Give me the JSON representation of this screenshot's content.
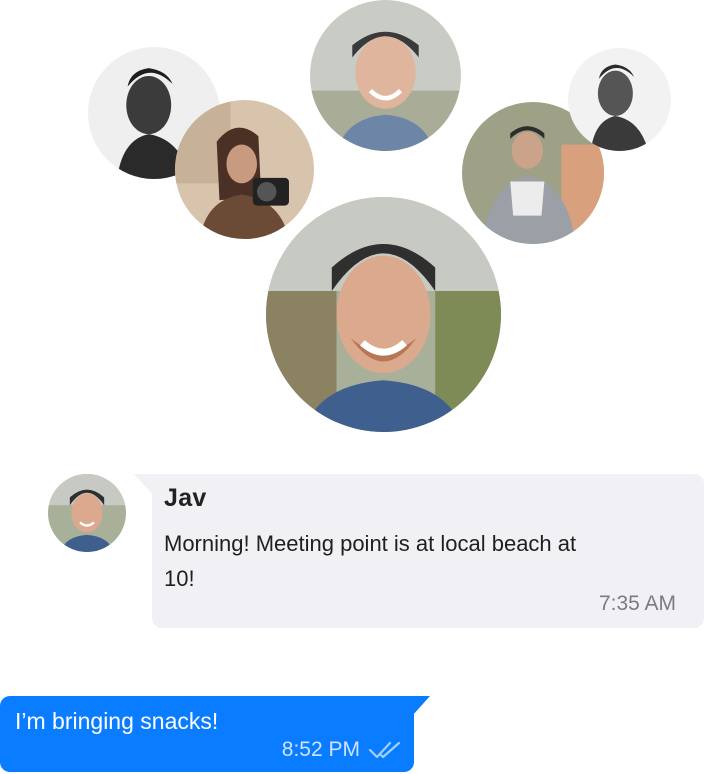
{
  "avatars": [
    {
      "id": "avatar-1",
      "icon": "person-portrait-bw-icon",
      "palette": "grayscale"
    },
    {
      "id": "avatar-2",
      "icon": "person-with-camera-icon",
      "palette": "warm"
    },
    {
      "id": "avatar-3",
      "icon": "person-smiling-cap-icon",
      "palette": "faded"
    },
    {
      "id": "avatar-4",
      "icon": "person-outdoors-icon",
      "palette": "warm-faded"
    },
    {
      "id": "avatar-5",
      "icon": "person-portrait-bw-icon",
      "palette": "grayscale-faded"
    },
    {
      "id": "avatar-6",
      "icon": "person-smiling-cap-icon",
      "palette": "color"
    }
  ],
  "incoming_message": {
    "sender": "Jav",
    "text": "Morning! Meeting point is at local beach at 10!",
    "time": "7:35 AM",
    "avatar_icon": "person-smiling-cap-icon",
    "bubble_color": "#f1f1f5"
  },
  "outgoing_message": {
    "text": "I’m bringing snacks!",
    "time": "8:52 PM",
    "status_icon": "double-check-icon",
    "bubble_color": "#0a7cff"
  }
}
